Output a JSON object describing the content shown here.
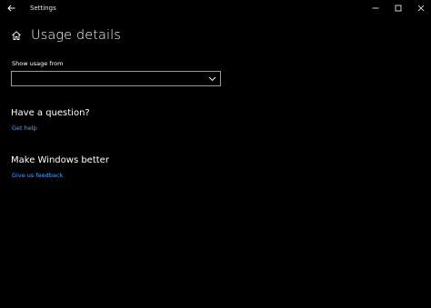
{
  "titlebar": {
    "app_title": "Settings",
    "back_icon": "back-arrow-icon",
    "minimize_icon": "minimize-icon",
    "maximize_icon": "maximize-icon",
    "close_icon": "close-icon"
  },
  "header": {
    "home_icon": "home-icon",
    "title": "Usage details"
  },
  "usage": {
    "label": "Show usage from",
    "selected_value": "",
    "chevron_icon": "chevron-down-icon"
  },
  "question": {
    "heading": "Have a question?",
    "link": "Get help"
  },
  "feedback": {
    "heading": "Make Windows better",
    "link": "Give us feedback"
  },
  "colors": {
    "background": "#000000",
    "text": "#ffffff",
    "link": "#4ea1ff",
    "dropdown_border": "#9a9a9a"
  }
}
